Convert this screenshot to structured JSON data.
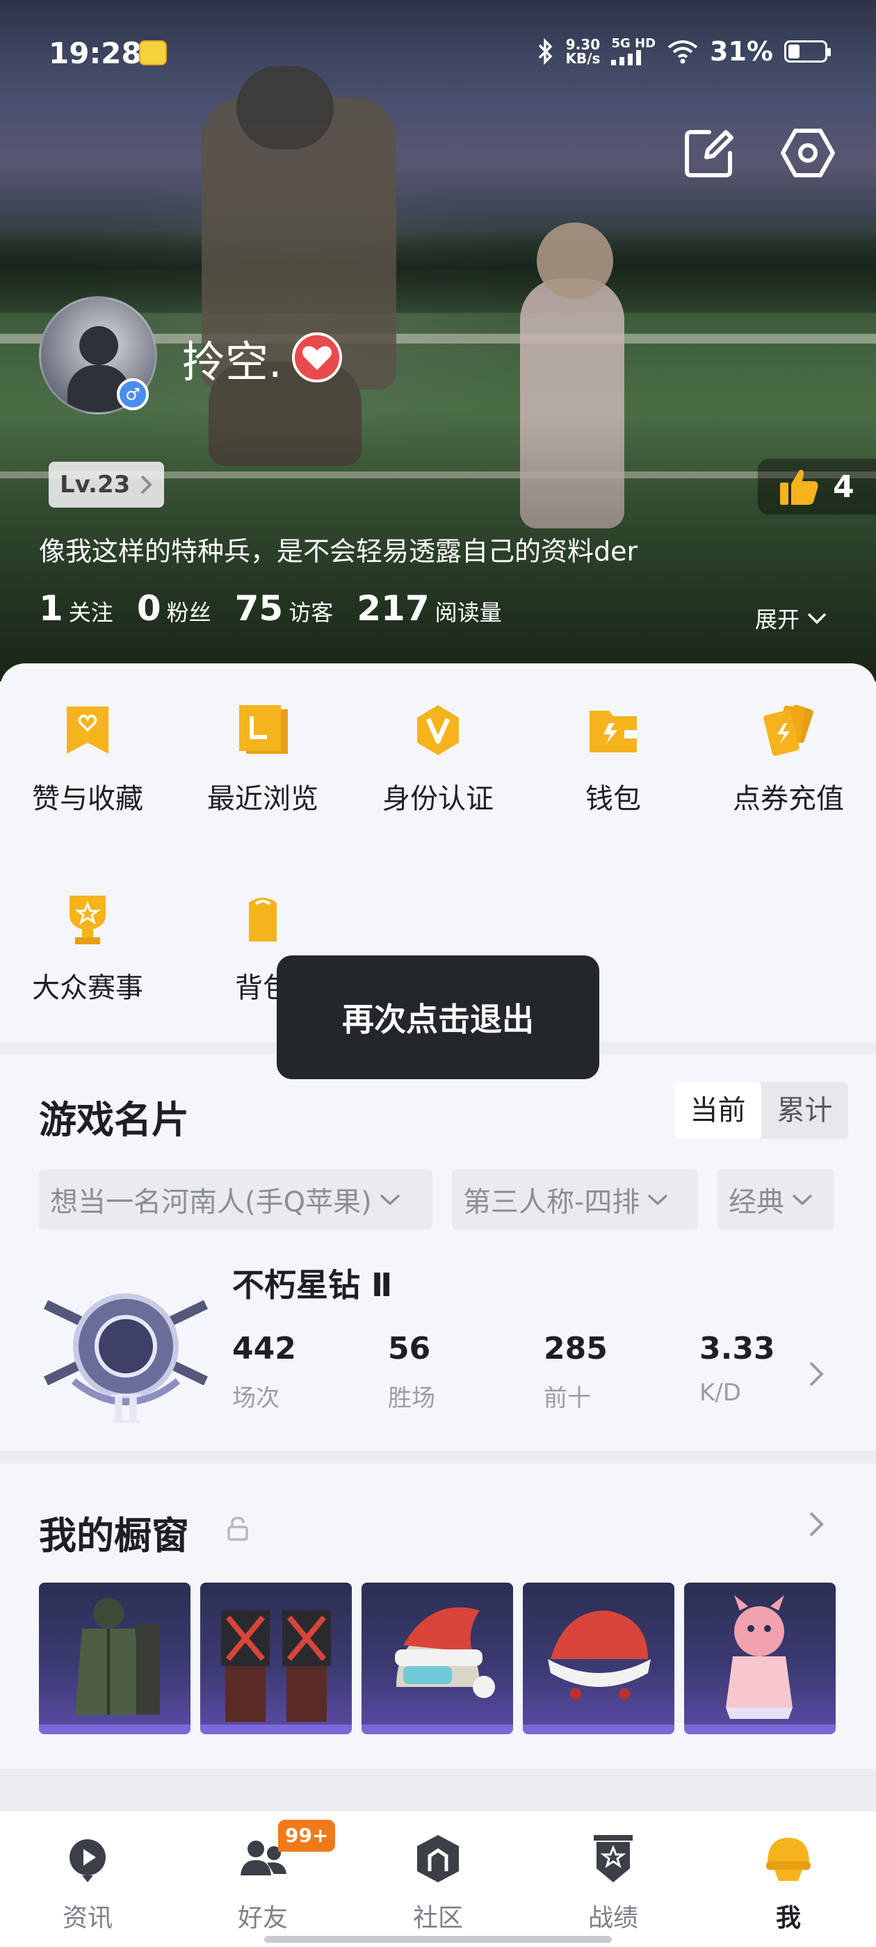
{
  "status_bar": {
    "time": "19:28",
    "net_speed_value": "9.30",
    "net_speed_unit": "KB/s",
    "network": "5G HD",
    "battery": "31%",
    "battery_level": 0.31
  },
  "profile": {
    "nickname": "拎空.",
    "level": "Lv.23",
    "likes": "4",
    "signature": "像我这样的特种兵，是不会轻易透露自己的资料der",
    "stats": [
      {
        "value": "1",
        "label": "关注"
      },
      {
        "value": "0",
        "label": "粉丝"
      },
      {
        "value": "75",
        "label": "访客"
      },
      {
        "value": "217",
        "label": "阅读量"
      }
    ],
    "expand_label": "展开"
  },
  "quick_menu": [
    {
      "label": "赞与收藏",
      "icon": "heart-bookmark-icon"
    },
    {
      "label": "最近浏览",
      "icon": "recent-files-icon"
    },
    {
      "label": "身份认证",
      "icon": "verified-v-icon"
    },
    {
      "label": "钱包",
      "icon": "wallet-icon"
    },
    {
      "label": "点券充值",
      "icon": "coupon-cards-icon"
    },
    {
      "label": "大众赛事",
      "icon": "trophy-icon"
    },
    {
      "label": "背包",
      "icon": "backpack-icon"
    }
  ],
  "toast": "再次点击退出",
  "game_card": {
    "title": "游戏名片",
    "segments": [
      "当前",
      "累计"
    ],
    "active_segment": "当前",
    "filters": [
      "想当一名河南人(手Q苹果)",
      "第三人称-四排",
      "经典"
    ],
    "rank_name": "不朽星钻 Ⅱ",
    "rank_emblem_numeral": "Ⅱ",
    "stats": [
      {
        "value": "442",
        "label": "场次"
      },
      {
        "value": "56",
        "label": "胜场"
      },
      {
        "value": "285",
        "label": "前十"
      },
      {
        "value": "3.33",
        "label": "K/D"
      }
    ]
  },
  "showcase": {
    "title": "我的橱窗",
    "items": [
      "green-military-coat-outfit",
      "red-black-outfit",
      "santa-hat-helmet",
      "santa-hat-red",
      "pink-mascot-costume"
    ]
  },
  "bottom_nav": {
    "items": [
      {
        "label": "资讯",
        "icon": "news-play-icon"
      },
      {
        "label": "好友",
        "icon": "friends-icon"
      },
      {
        "label": "社区",
        "icon": "community-icon"
      },
      {
        "label": "战绩",
        "icon": "battle-record-icon"
      },
      {
        "label": "我",
        "icon": "me-helmet-icon"
      }
    ],
    "friends_badge": "99+",
    "active": "我"
  },
  "colors": {
    "accent_orange": "#f5b31d",
    "badge_orange": "#f07a1a",
    "heart_red": "#e94b4b",
    "gender_blue": "#4a8df0"
  }
}
